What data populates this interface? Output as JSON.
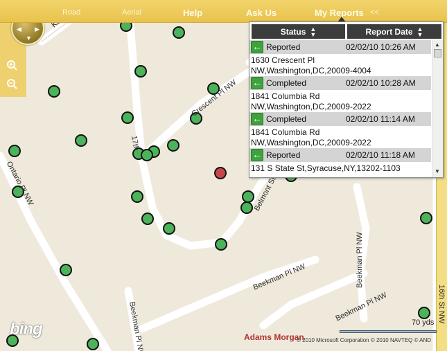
{
  "nav": {
    "road": "Road",
    "aerial": "Aerial",
    "help": "Help",
    "ask_us": "Ask Us",
    "my_reports": "My Reports",
    "collapse": "<<"
  },
  "map": {
    "streets": [
      {
        "name": "Kalorama Rd",
        "label": "Kalorama"
      },
      {
        "name": "Crescent Pl NW",
        "label": "Crescent Pl NW"
      },
      {
        "name": "17th St NW",
        "label": "17th"
      },
      {
        "name": "Ontario Pl NW",
        "label": "Ontario Pl NW"
      },
      {
        "name": "Belmont St NW",
        "label": "Belmont St"
      },
      {
        "name": "Beekman Pl NW (east-west)",
        "label": "Beekman Pl NW"
      },
      {
        "name": "Beekman Pl NW (north-south)",
        "label": "Beekman Pl NW"
      },
      {
        "name": "Beekman Pl NW (lower)",
        "label": "Beekman Pl NW"
      },
      {
        "name": "Beekman Pl NW (diagonal)",
        "label": "Beekman Pl NW"
      },
      {
        "name": "16th St NW",
        "label": "16th St NW"
      }
    ],
    "neighborhood": "Adams Morgan",
    "scale": "70 yds",
    "copyright": "© 2010 Microsoft Corporation   © 2010 NAVTEQ   © AND",
    "logo": "bing",
    "marker_colors": {
      "open": "#c8464a",
      "other": "#4cb35a"
    }
  },
  "reports_panel": {
    "columns": [
      "Status",
      "Report Date"
    ],
    "reports": [
      {
        "status": "Reported",
        "date": "02/02/10 10:26 AM",
        "address_line1": "1630 Crescent Pl",
        "address_line2": "NW,Washington,DC,20009-4004"
      },
      {
        "status": "Completed",
        "date": "02/02/10 10:28 AM",
        "address_line1": "1841 Columbia Rd",
        "address_line2": "NW,Washington,DC,20009-2022"
      },
      {
        "status": "Completed",
        "date": "02/02/10 11:14 AM",
        "address_line1": "1841 Columbia Rd",
        "address_line2": "NW,Washington,DC,20009-2022"
      },
      {
        "status": "Reported",
        "date": "02/02/10 11:18 AM",
        "address_line1": "131 S State St,Syracuse,NY,13202-1103",
        "address_line2": ""
      }
    ]
  }
}
